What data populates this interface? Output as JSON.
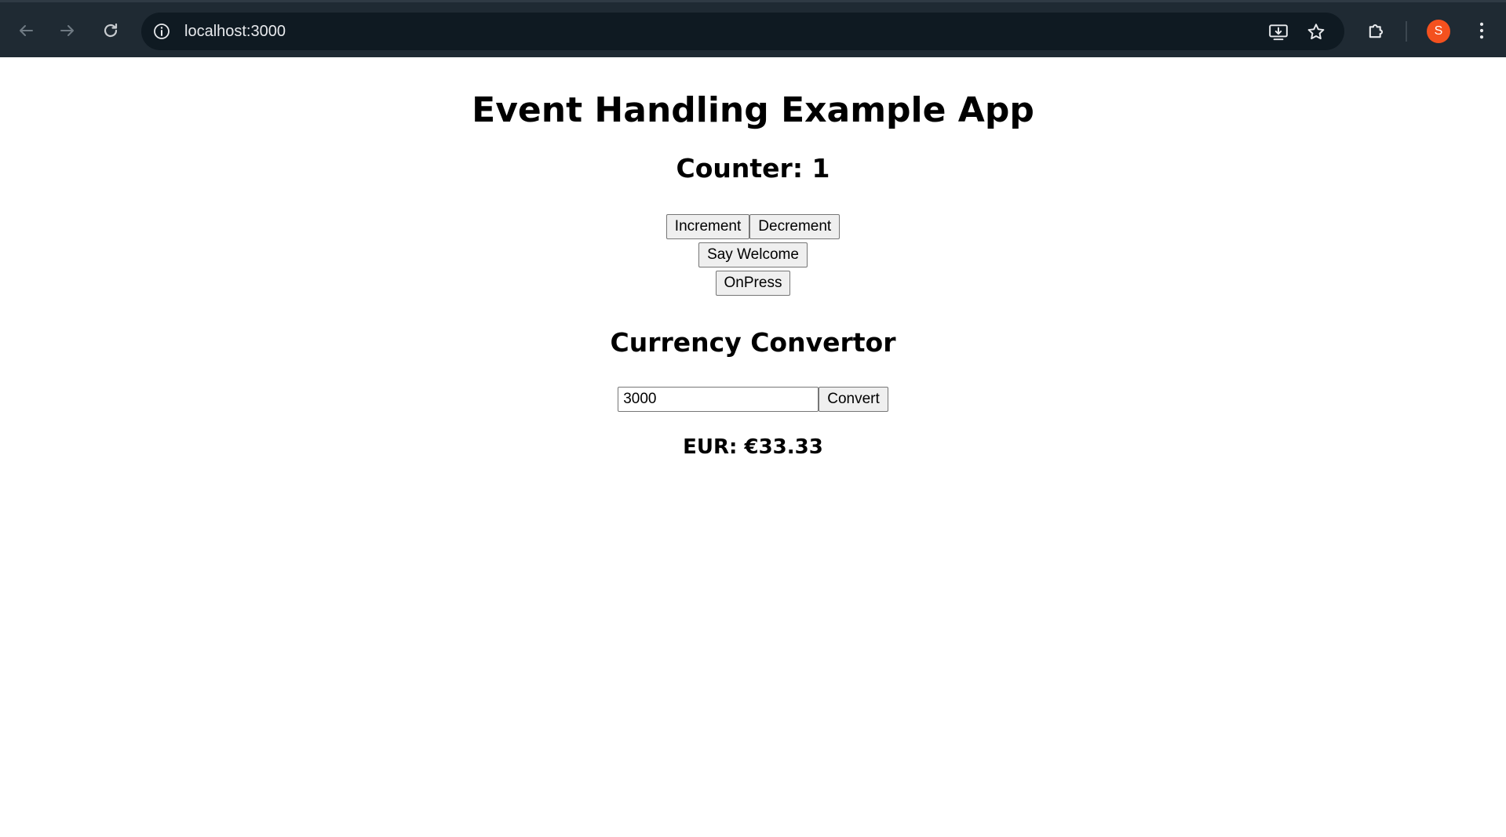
{
  "browser": {
    "url": "localhost:3000",
    "profile_initial": "S",
    "profile_color": "#f4511e"
  },
  "app": {
    "title": "Event Handling Example App",
    "counter": {
      "label": "Counter: 1",
      "increment_label": "Increment",
      "decrement_label": "Decrement",
      "welcome_label": "Say Welcome",
      "onpress_label": "OnPress"
    },
    "currency": {
      "title": "Currency Convertor",
      "input_value": "3000",
      "convert_label": "Convert",
      "result": "EUR: €33.33"
    }
  }
}
